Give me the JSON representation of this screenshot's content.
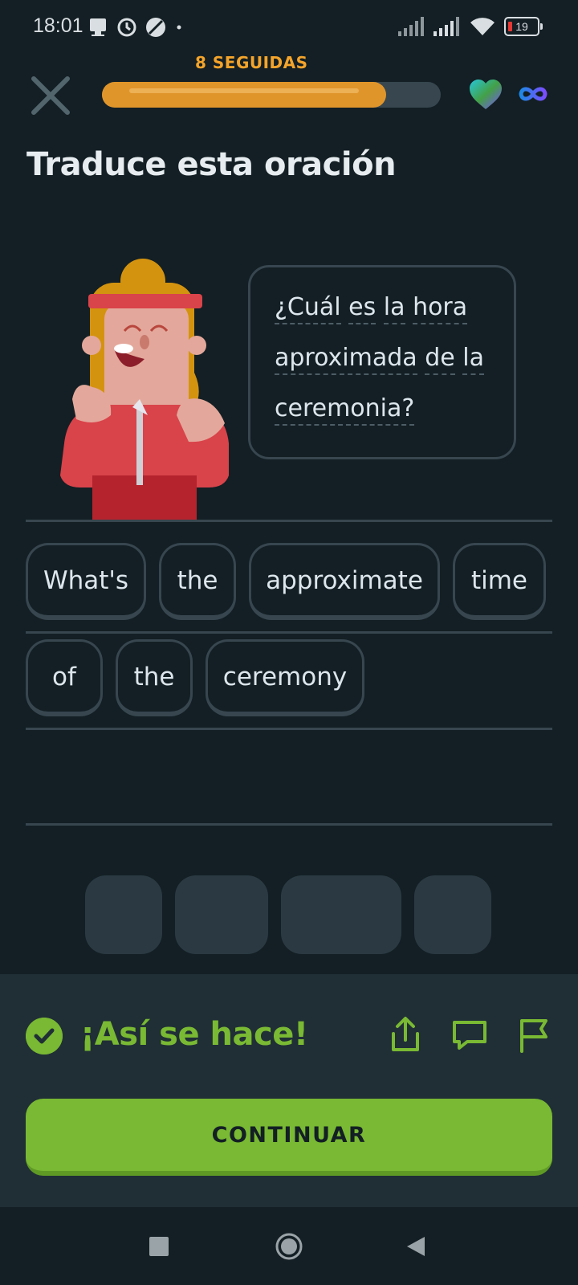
{
  "status_bar": {
    "time": "18:01",
    "battery": "19",
    "icons": [
      "notification-icon",
      "vpn-icon",
      "do-not-disturb-icon",
      "signal-icon",
      "wifi-icon",
      "battery-icon"
    ]
  },
  "header": {
    "streak_label": "8 SEGUIDAS",
    "progress_fraction": 0.84,
    "colors": {
      "progress": "#e0952b",
      "streak": "#f4a42b"
    }
  },
  "prompt": {
    "title": "Traduce esta oración"
  },
  "bubble": {
    "lines": [
      [
        "¿Cuál",
        "es",
        "la",
        "hora"
      ],
      [
        "aproximada",
        "de",
        "la"
      ],
      [
        "ceremonia?"
      ]
    ]
  },
  "answer_chips": {
    "row1": [
      "What's",
      "the",
      "approximate",
      "time"
    ],
    "row2": [
      "of",
      "the",
      "ceremony"
    ]
  },
  "feedback": {
    "message": "¡Así se hace!",
    "continue_label": "CONTINUAR",
    "accent": "#79b933"
  }
}
